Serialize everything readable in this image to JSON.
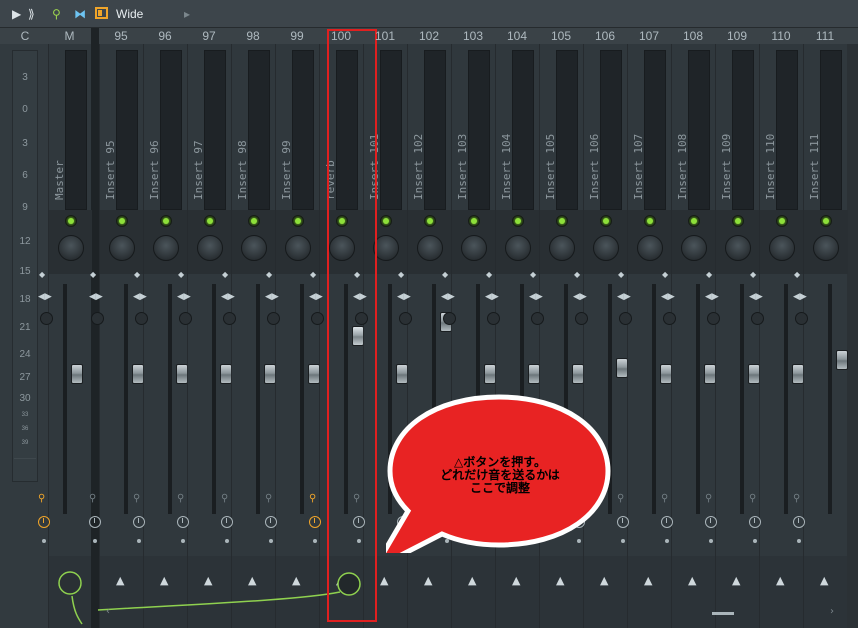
{
  "toolbar": {
    "play_icon": "▶",
    "bird_icon": "⟫",
    "pin_icon": "⚲",
    "link_icon": "⧓",
    "wide_label": "Wide",
    "arrow_icon": "▸"
  },
  "meter": {
    "header_c": "C",
    "header_m": "M",
    "db_labels": [
      "3",
      "0",
      "3",
      "6",
      "9",
      "12",
      "15",
      "18",
      "21",
      "24",
      "27",
      "30",
      "33",
      "36",
      "39"
    ]
  },
  "master": {
    "header": "M",
    "name": "Master"
  },
  "strips": [
    {
      "header": "95",
      "name": "Insert 95"
    },
    {
      "header": "96",
      "name": "Insert 96"
    },
    {
      "header": "97",
      "name": "Insert 97"
    },
    {
      "header": "98",
      "name": "Insert 98"
    },
    {
      "header": "99",
      "name": "Insert 99"
    },
    {
      "header": "100",
      "name": "reverb"
    },
    {
      "header": "101",
      "name": "Insert 101"
    },
    {
      "header": "102",
      "name": "Insert 102"
    },
    {
      "header": "103",
      "name": "Insert 103"
    },
    {
      "header": "104",
      "name": "Insert 104"
    },
    {
      "header": "105",
      "name": "Insert 105"
    },
    {
      "header": "106",
      "name": "Insert 106"
    },
    {
      "header": "107",
      "name": "Insert 107"
    },
    {
      "header": "108",
      "name": "Insert 108"
    },
    {
      "header": "109",
      "name": "Insert 109"
    },
    {
      "header": "110",
      "name": "Insert 110"
    },
    {
      "header": "111",
      "name": "Insert 111"
    }
  ],
  "annotation": {
    "line1": "△ボタンを押す。",
    "line2": "どれだけ音を送るかは",
    "line3": "ここで調整"
  },
  "colors": {
    "accent_green": "#8de03a",
    "accent_orange": "#f0a52a",
    "highlight_red": "#e02020",
    "route_line": "#8fd14f"
  },
  "icons": {
    "send": "▲",
    "updown": "◆",
    "lr": "◀▶",
    "mic": "🎙"
  }
}
